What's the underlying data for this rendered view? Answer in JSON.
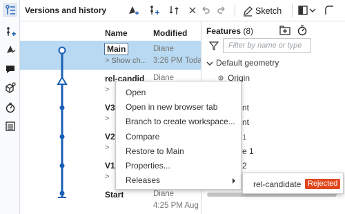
{
  "panel": {
    "title": "Versions and history"
  },
  "toolbar": {
    "sketch_label": "Sketch"
  },
  "colors": {
    "accent": "#1a5fb4",
    "selection": "#b8d9f1",
    "rejected": "#e0461c"
  },
  "columns": {
    "name": "Name",
    "modified": "Modified"
  },
  "versions": [
    {
      "name": "Main",
      "sub": "> Show ch...",
      "who": "Diane",
      "when": "3:26 PM Toda"
    },
    {
      "name": "rel-candid",
      "sub": ">",
      "who": "Diane",
      "when": ""
    },
    {
      "name": "V3",
      "sub": ">",
      "who": "",
      "when": ""
    },
    {
      "name": "V2",
      "sub": ">",
      "who": "",
      "when": ""
    },
    {
      "name": "V1",
      "sub": ">",
      "who": "",
      "when": ""
    },
    {
      "name": "Start",
      "sub": "",
      "who": "Diane",
      "when": "4:25 PM Aug"
    }
  ],
  "features": {
    "title": "Features",
    "count": "(8)",
    "filter_placeholder": "Filter by name or type",
    "items": [
      "Default geometry",
      "Origin",
      "nt",
      "nt",
      "1",
      "e 1",
      "2"
    ]
  },
  "context_menu": {
    "items": [
      "Open",
      "Open in new browser tab",
      "Branch to create workspace...",
      "Compare",
      "Restore to Main",
      "Properties...",
      "Releases"
    ]
  },
  "submenu": {
    "release": "rel-candidate",
    "status": "Rejected"
  }
}
